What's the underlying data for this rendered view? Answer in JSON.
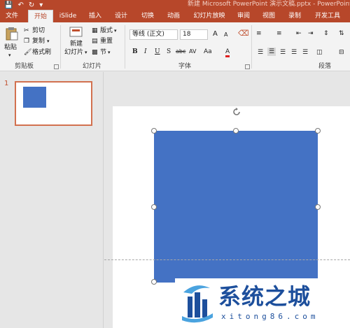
{
  "window": {
    "title": "新建 Microsoft PowerPoint 演示文稿.pptx - PowerPoint"
  },
  "quick_access": [
    {
      "icon": "save-icon"
    },
    {
      "icon": "undo-icon"
    },
    {
      "icon": "redo-icon"
    },
    {
      "icon": "customize-qat-icon"
    }
  ],
  "tabs": [
    "文件",
    "开始",
    "iSlide",
    "插入",
    "设计",
    "切换",
    "动画",
    "幻灯片放映",
    "审阅",
    "视图",
    "录制",
    "开发工具"
  ],
  "active_tab": "开始",
  "ribbon": {
    "clipboard": {
      "paste": "粘贴",
      "cut": "剪切",
      "copy": "复制",
      "format_painter": "格式刷",
      "label": "剪贴板"
    },
    "slides": {
      "new_slide_line1": "新建",
      "new_slide_line2": "幻灯片",
      "layout": "版式",
      "reset": "重置",
      "section": "节",
      "label": "幻灯片"
    },
    "font": {
      "family": "等线 (正文)",
      "size": "18",
      "bold": "B",
      "italic": "I",
      "underline": "U",
      "shadow": "S",
      "strike": "abc",
      "spacing": "AV",
      "case": "Aa",
      "color": "A",
      "label": "字体",
      "grow": "A",
      "shrink": "A"
    },
    "paragraph": {
      "label": "段落"
    }
  },
  "thumbnails": [
    {
      "number": "1"
    }
  ],
  "colors": {
    "accent": "#b7472a",
    "shape_fill": "#4472c4",
    "thumb_border": "#d2714f",
    "watermark": "#1d4f9c"
  },
  "watermark": {
    "title": "系统之城",
    "url": "xitong86.com"
  }
}
